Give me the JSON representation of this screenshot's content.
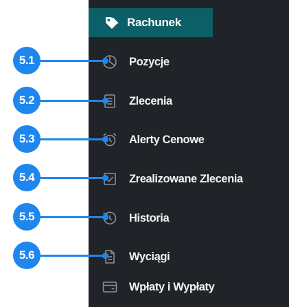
{
  "header": {
    "label": "Rachunek",
    "icon": "tag-icon",
    "background": "#0d5f67"
  },
  "menu": {
    "background": "#202327",
    "items": [
      {
        "label": "Pozycje",
        "icon": "pie-chart-icon"
      },
      {
        "label": "Zlecenia",
        "icon": "document-list-icon"
      },
      {
        "label": "Alerty Cenowe",
        "icon": "alarm-clock-icon"
      },
      {
        "label": "Zrealizowane Zlecenia",
        "icon": "checkbox-icon"
      },
      {
        "label": "Historia",
        "icon": "history-clock-icon"
      },
      {
        "label": "Wyciągi",
        "icon": "statement-document-icon"
      },
      {
        "label": "Wpłaty i Wypłaty",
        "icon": "card-icon"
      }
    ]
  },
  "callouts": {
    "color": "#1f86ee",
    "labels": [
      "5.1",
      "5.2",
      "5.3",
      "5.4",
      "5.5",
      "5.6"
    ]
  }
}
